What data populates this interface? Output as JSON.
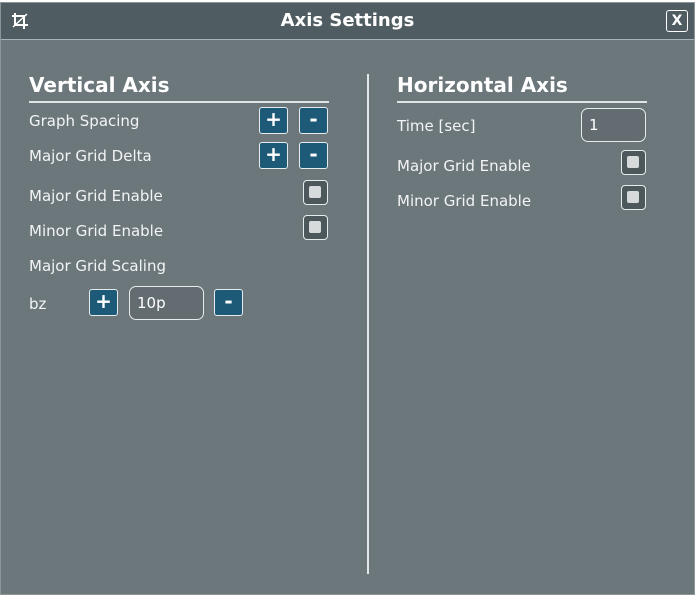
{
  "window": {
    "title": "Axis Settings",
    "close_label": "X"
  },
  "vertical": {
    "title": "Vertical Axis",
    "graph_spacing_label": "Graph Spacing",
    "major_grid_delta_label": "Major Grid Delta",
    "major_grid_enable_label": "Major Grid Enable",
    "minor_grid_enable_label": "Minor Grid Enable",
    "major_grid_scaling_label": "Major Grid Scaling",
    "scaling_unit_label": "bz",
    "scaling_value": "10p",
    "plus": "+",
    "minus": "-"
  },
  "horizontal": {
    "title": "Horizontal Axis",
    "time_label": "Time [sec]",
    "time_value": "1",
    "major_grid_enable_label": "Major Grid Enable",
    "minor_grid_enable_label": "Minor Grid Enable"
  }
}
